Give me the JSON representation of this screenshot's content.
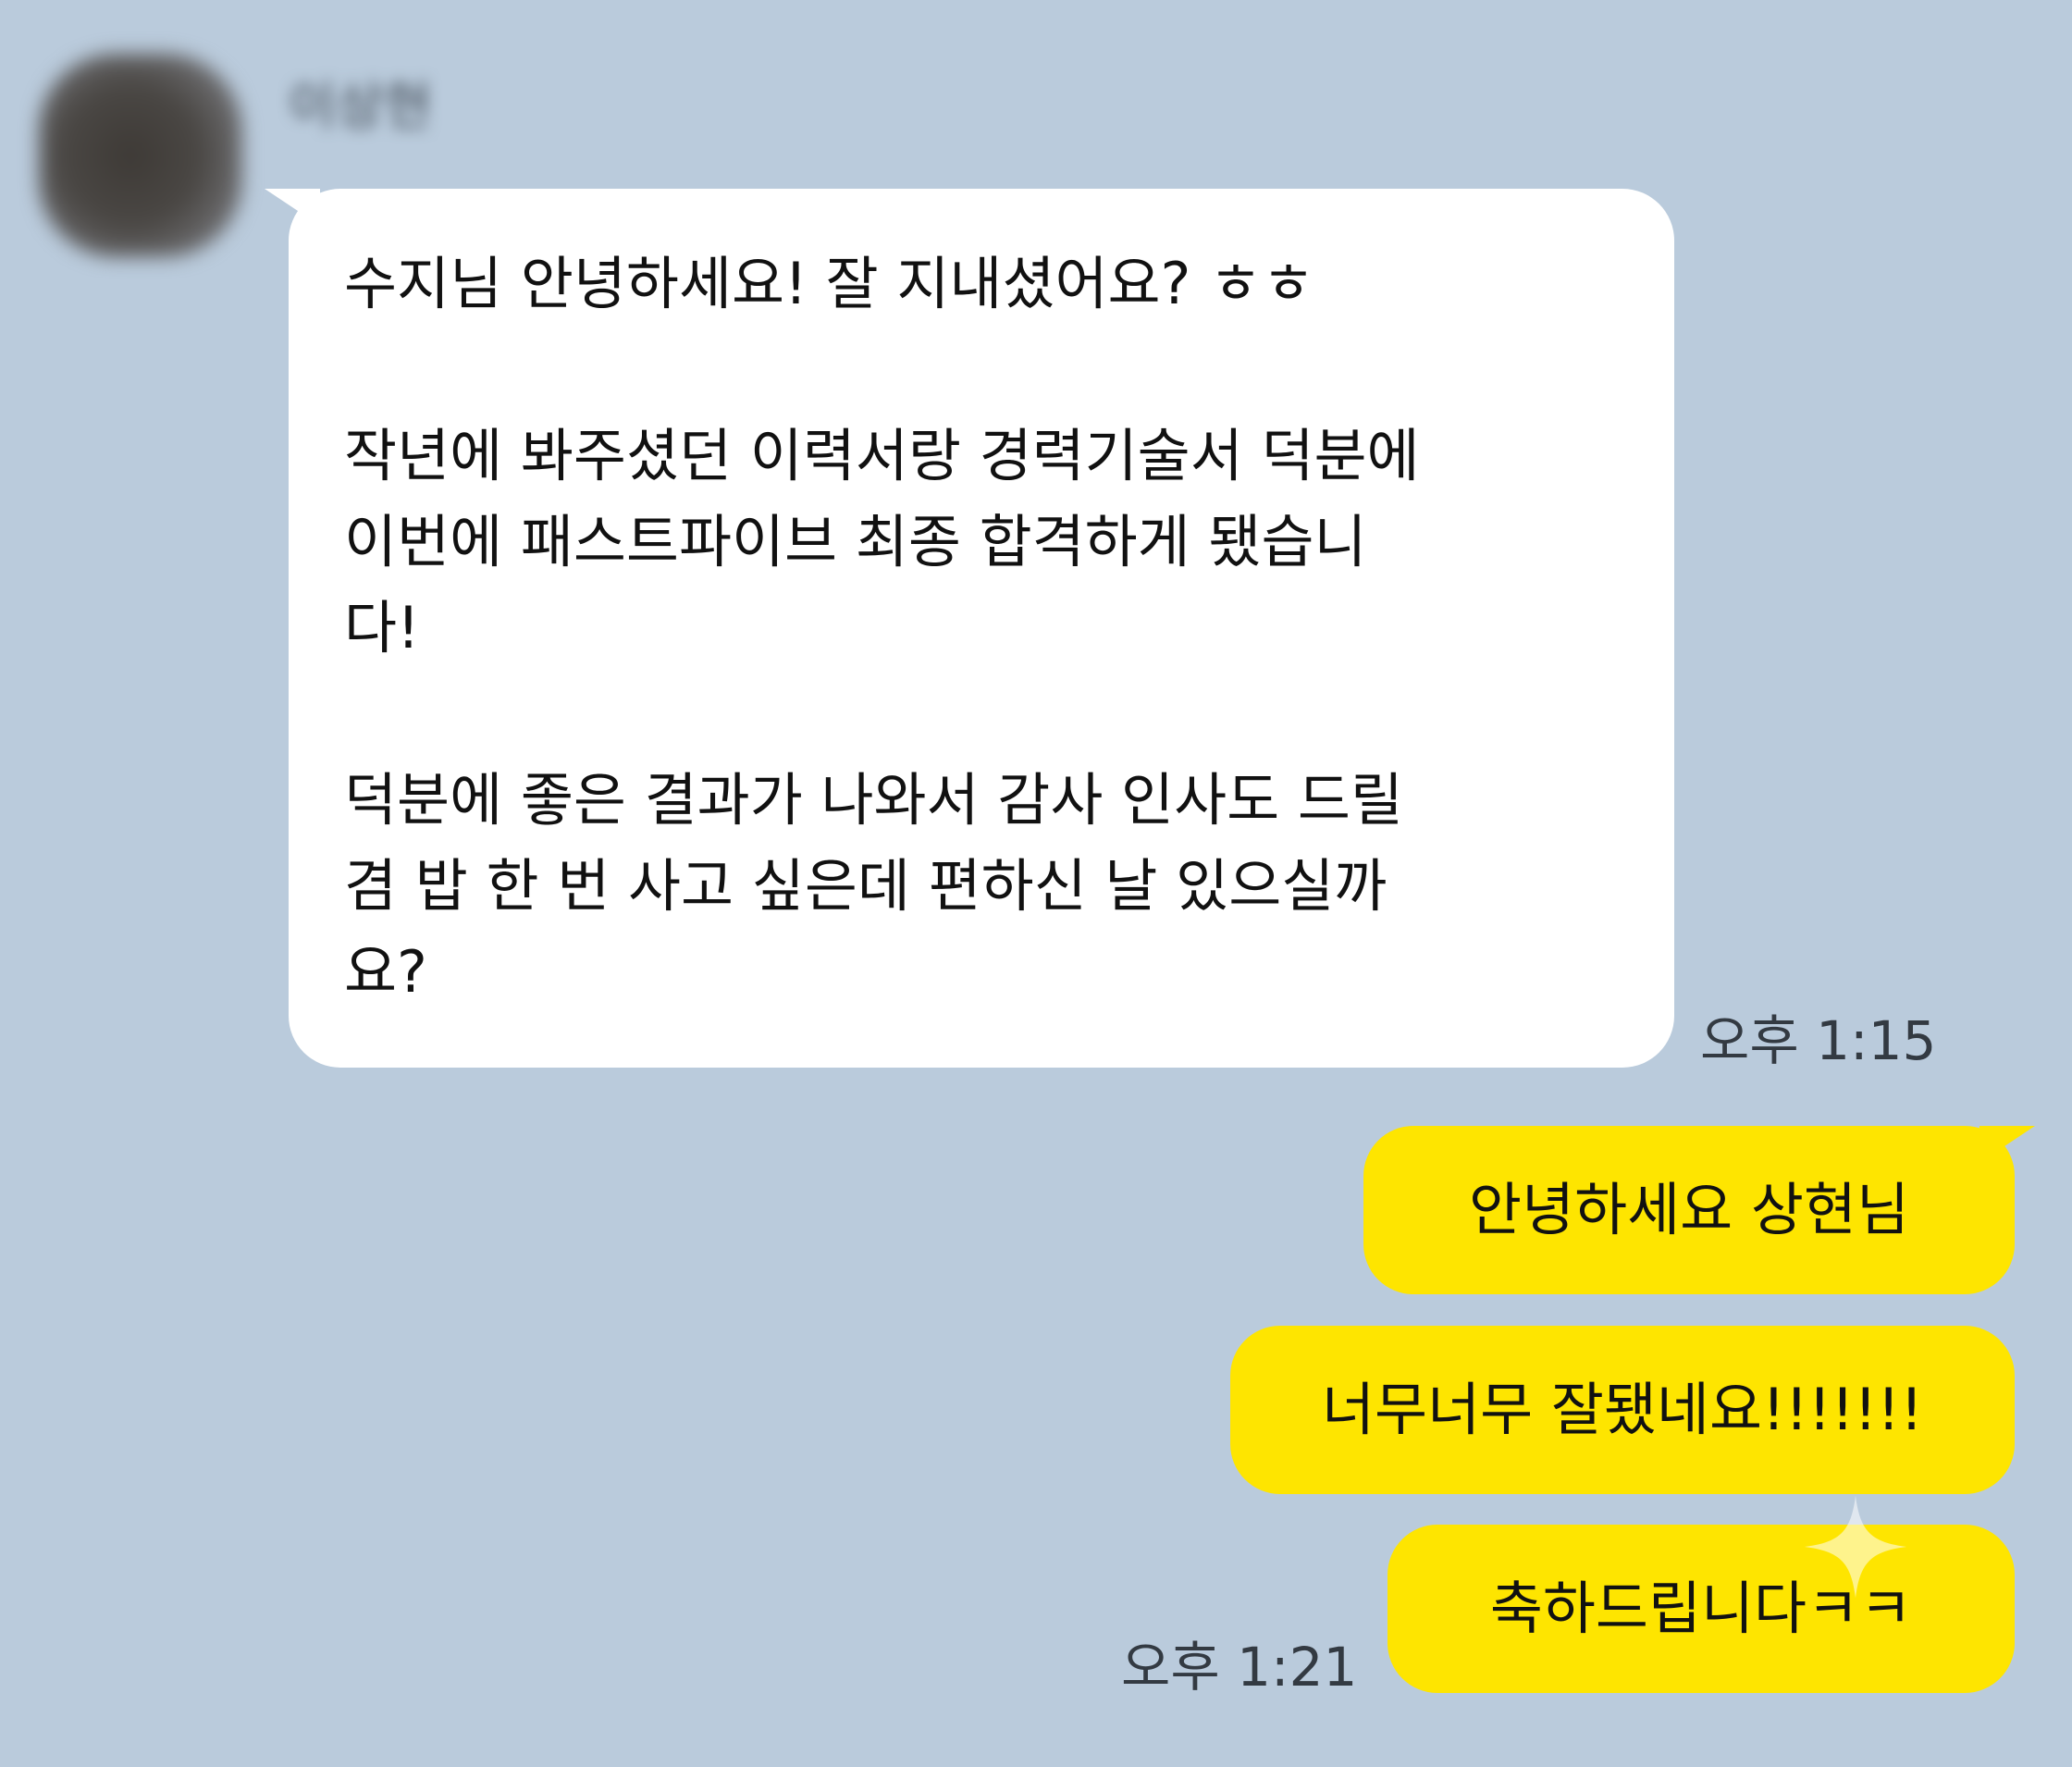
{
  "chat": {
    "sender_name": "이상현",
    "incoming": {
      "text": "수지님 안녕하세요! 잘 지내셨어요? ㅎㅎ\n\n작년에 봐주셨던 이력서랑 경력기술서 덕분에\n이번에 패스트파이브 최종 합격하게 됐습니\n다!\n\n덕분에 좋은 결과가 나와서 감사 인사도 드릴\n겸 밥 한 번 사고 싶은데 편하신 날 있으실까\n요?",
      "time": "오후 1:15"
    },
    "outgoing": [
      {
        "text": "안녕하세요 상현님"
      },
      {
        "text": "너무너무 잘됐네요!!!!!!!"
      },
      {
        "text": "축하드립니다ㅋㅋ"
      }
    ],
    "outgoing_time": "오후 1:21"
  },
  "colors": {
    "background": "#bacbdc",
    "incoming_bubble": "#ffffff",
    "outgoing_bubble": "#fee500"
  },
  "icons": {
    "sender_avatar": "avatar",
    "reaction_hint": "sparkle-icon"
  }
}
